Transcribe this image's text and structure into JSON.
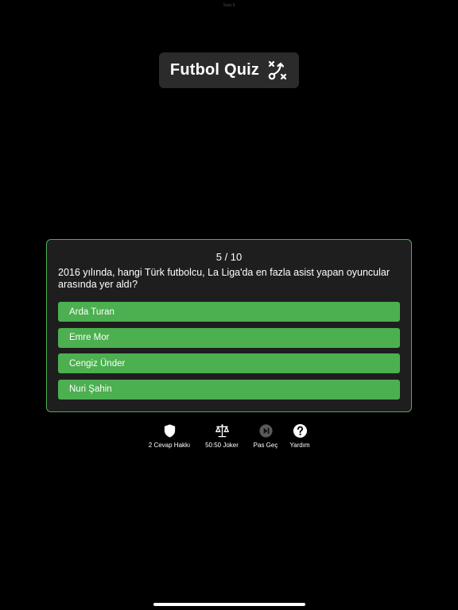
{
  "status_bar": {
    "text": "Saat 9"
  },
  "header": {
    "title": "Futbol Quiz",
    "icon": "tactics-icon"
  },
  "quiz": {
    "progress": "5 / 10",
    "question": "2016 yılında, hangi Türk futbolcu, La Liga'da en fazla asist yapan oyuncular arasında yer aldı?",
    "answers": [
      {
        "label": "Arda Turan"
      },
      {
        "label": "Emre Mor"
      },
      {
        "label": "Cengiz Ünder"
      },
      {
        "label": "Nuri Şahin"
      }
    ]
  },
  "toolbar": {
    "items": [
      {
        "label": "2 Cevap Hakkı",
        "icon": "shield-icon"
      },
      {
        "label": "50:50 Joker",
        "icon": "scale-icon"
      },
      {
        "label": "Pas Geç",
        "icon": "skip-forward-icon"
      },
      {
        "label": "Yardım",
        "icon": "help-icon"
      }
    ]
  },
  "colors": {
    "accent": "#4caf50",
    "card_background": "#1e1e1e",
    "title_background": "#2b2b2b",
    "page_background": "#000000",
    "skip_icon": "#5a5a5a"
  }
}
